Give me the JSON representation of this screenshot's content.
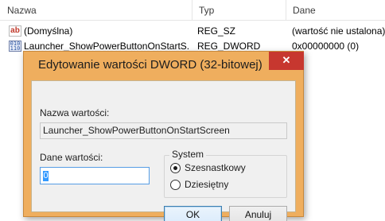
{
  "columns": {
    "name": "Nazwa",
    "type": "Typ",
    "data": "Dane"
  },
  "rows": [
    {
      "name": "(Domyślna)",
      "type": "REG_SZ",
      "data": "(wartość nie ustalona)",
      "icon": "string-value-icon"
    },
    {
      "name": "Launcher_ShowPowerButtonOnStartS...",
      "type": "REG_DWORD",
      "data": "0x00000000 (0)",
      "icon": "binary-value-icon"
    }
  ],
  "dialog": {
    "title": "Edytowanie wartości DWORD (32-bitowej)",
    "close_glyph": "✕",
    "value_name_label": "Nazwa wartości:",
    "value_name": "Launcher_ShowPowerButtonOnStartScreen",
    "value_data_label": "Dane wartości:",
    "value_data": "0",
    "base_group_label": "System",
    "base_options": [
      {
        "label": "Szesnastkowy",
        "selected": true
      },
      {
        "label": "Dziesiętny",
        "selected": false
      }
    ],
    "ok_label": "OK",
    "cancel_label": "Anuluj"
  }
}
